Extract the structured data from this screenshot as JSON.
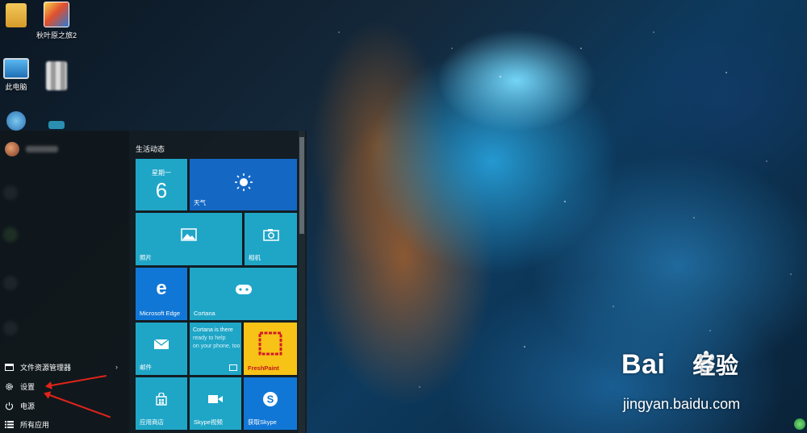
{
  "desktop": {
    "icons": [
      {
        "label": "",
        "icon": "user-folder-icon"
      },
      {
        "label": "秋叶原之旅2",
        "icon": "game-shortcut-icon"
      },
      {
        "label": "此电脑",
        "icon": "this-pc-icon"
      },
      {
        "label": "",
        "icon": "blurred-icon"
      }
    ]
  },
  "start_menu": {
    "group_title": "生活动态",
    "left_items": [
      {
        "label": "文件资源管理器",
        "icon": "file-explorer-icon",
        "chevron": "›"
      },
      {
        "label": "设置",
        "icon": "gear-icon"
      },
      {
        "label": "电源",
        "icon": "power-icon"
      },
      {
        "label": "所有应用",
        "icon": "all-apps-icon"
      }
    ],
    "tiles": {
      "calendar": {
        "weekday": "星期一",
        "day": "6"
      },
      "weather": {
        "label": "天气"
      },
      "photos": {
        "label": "照片"
      },
      "camera": {
        "label": "相机"
      },
      "edge": {
        "label": "Microsoft Edge"
      },
      "cortana": {
        "label": "Cortana"
      },
      "mail": {
        "label": "邮件"
      },
      "cortana_phone": {
        "line1": "Cortana is there",
        "line2": "ready to help",
        "line3": "on your phone, too"
      },
      "freshpaint": {
        "label": "FreshPaint"
      },
      "store": {
        "label": "应用商店"
      },
      "skype_video": {
        "label": "Skype视频"
      },
      "skype": {
        "label": "获取Skype"
      }
    }
  },
  "watermark": {
    "brand": "Bai",
    "brand2": "经验",
    "url": "jingyan.baidu.com"
  },
  "colors": {
    "tile_teal": "#1fa6c7",
    "tile_blue": "#1468c4",
    "tile_edge_blue": "#1177d6",
    "tile_yellow": "#f7c316",
    "arrow_red": "#e2231a"
  }
}
